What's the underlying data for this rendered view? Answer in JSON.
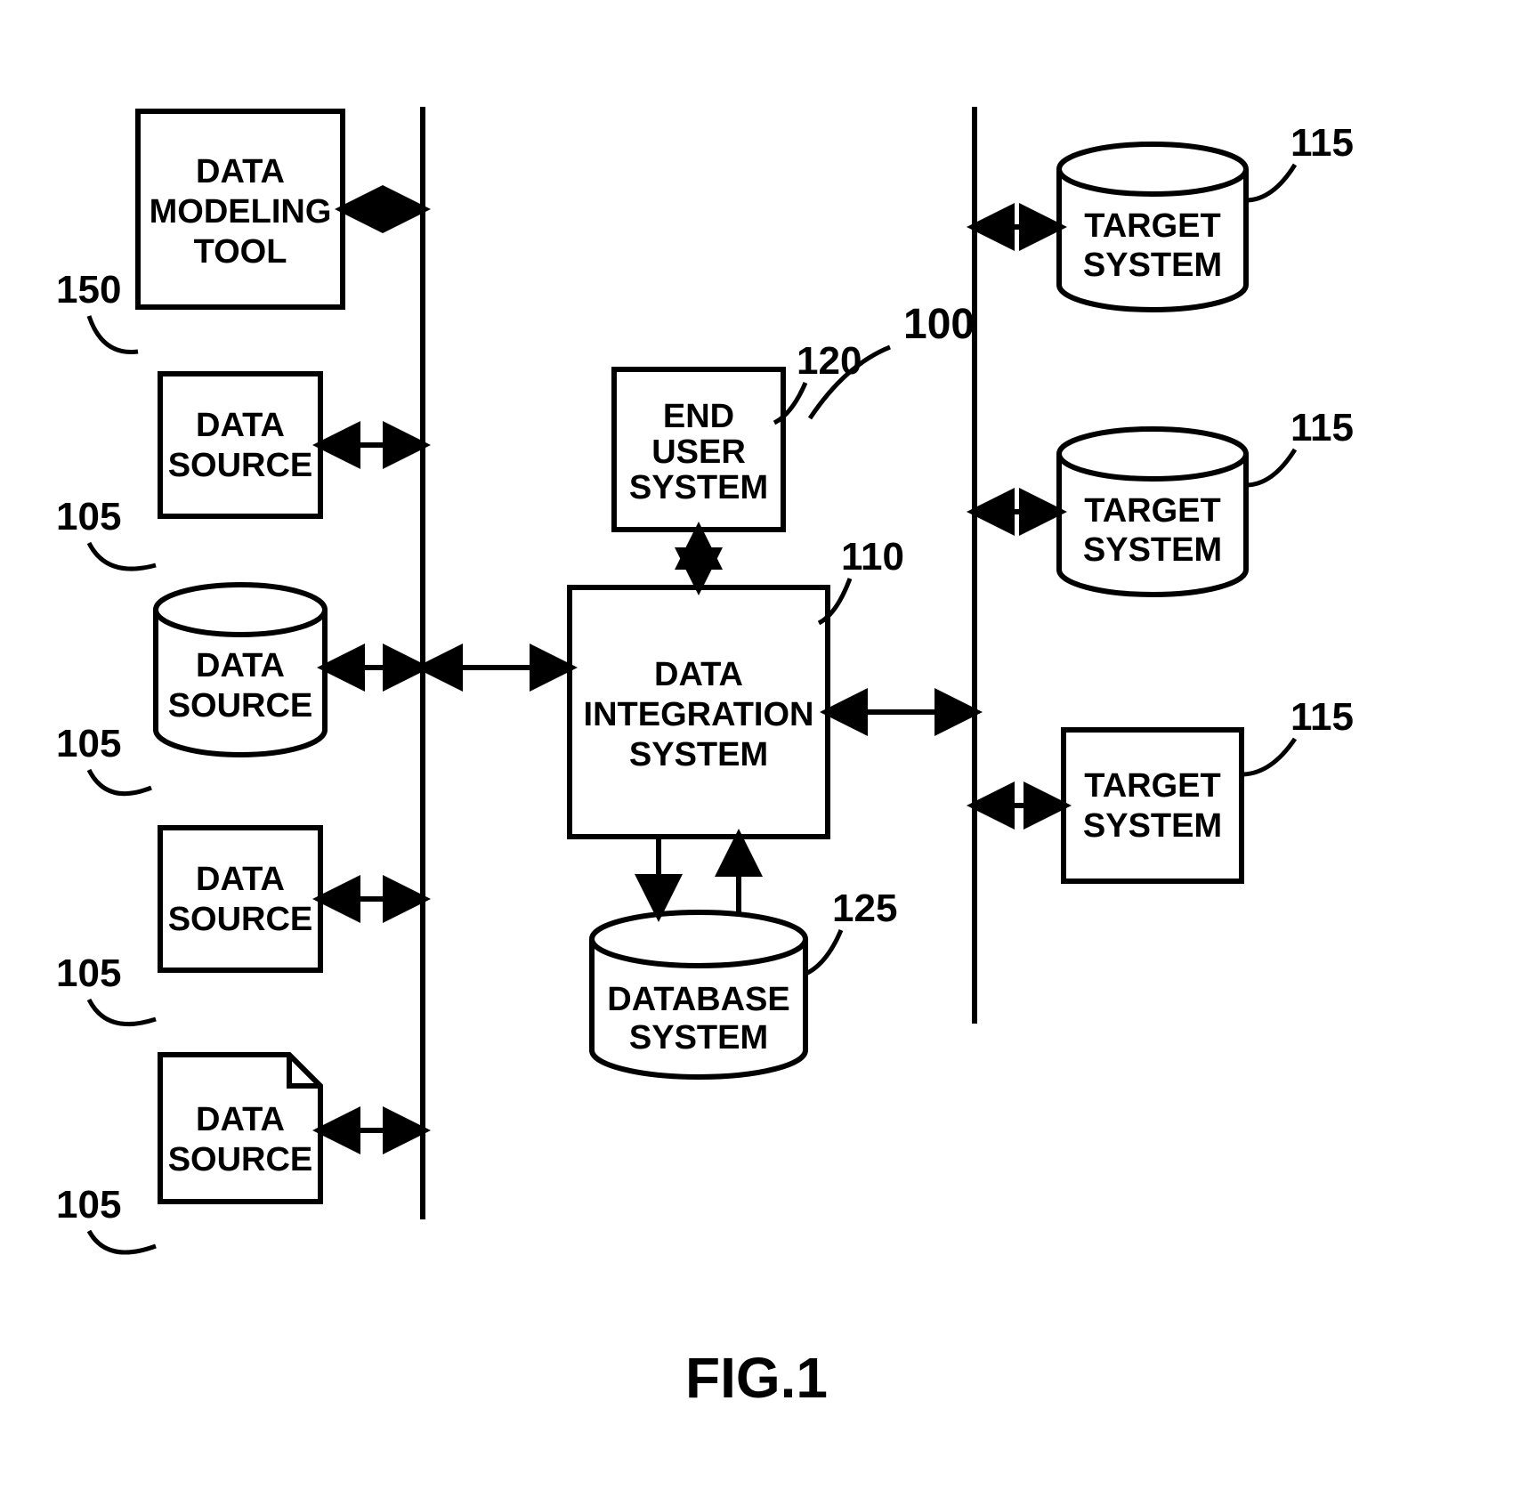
{
  "figure_label": "FIG.1",
  "overall_ref": "100",
  "nodes": {
    "data_modeling_tool": {
      "line1": "DATA",
      "line2": "MODELING",
      "line3": "TOOL",
      "ref": "150"
    },
    "data_source_1": {
      "line1": "DATA",
      "line2": "SOURCE",
      "ref": "105"
    },
    "data_source_2": {
      "line1": "DATA",
      "line2": "SOURCE",
      "ref": "105"
    },
    "data_source_3": {
      "line1": "DATA",
      "line2": "SOURCE",
      "ref": "105"
    },
    "data_source_4": {
      "line1": "DATA",
      "line2": "SOURCE",
      "ref": "105"
    },
    "end_user_system": {
      "line1": "END",
      "line2": "USER",
      "line3": "SYSTEM",
      "ref": "120"
    },
    "data_integration_system": {
      "line1": "DATA",
      "line2": "INTEGRATION",
      "line3": "SYSTEM",
      "ref": "110"
    },
    "database_system": {
      "line1": "DATABASE",
      "line2": "SYSTEM",
      "ref": "125"
    },
    "target_system_1": {
      "line1": "TARGET",
      "line2": "SYSTEM",
      "ref": "115"
    },
    "target_system_2": {
      "line1": "TARGET",
      "line2": "SYSTEM",
      "ref": "115"
    },
    "target_system_3": {
      "line1": "TARGET",
      "line2": "SYSTEM",
      "ref": "115"
    }
  }
}
